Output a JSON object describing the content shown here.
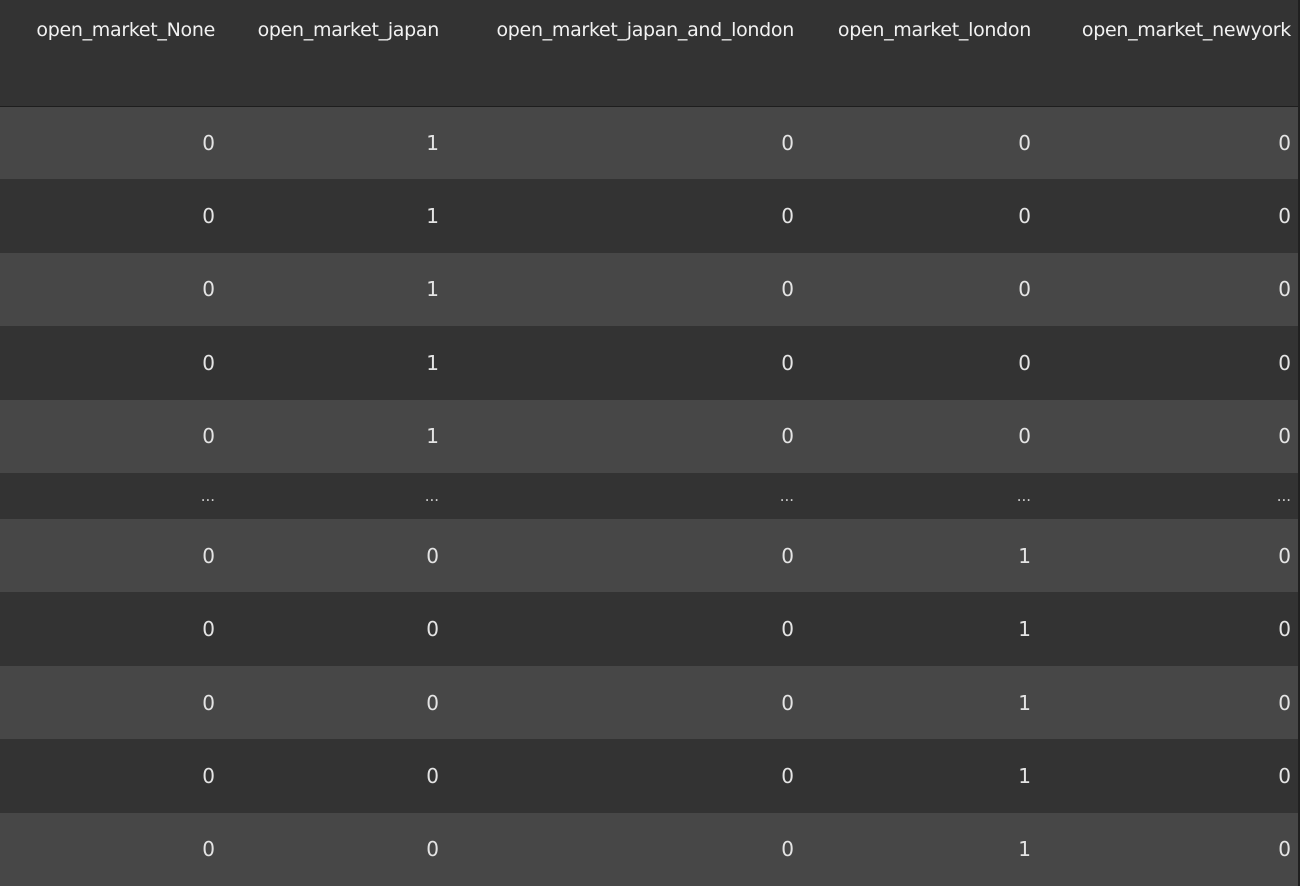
{
  "table": {
    "columns": [
      "open_market_None",
      "open_market_japan",
      "open_market_japan_and_london",
      "open_market_london",
      "open_market_newyork"
    ],
    "rows": [
      [
        "0",
        "1",
        "0",
        "0",
        "0"
      ],
      [
        "0",
        "1",
        "0",
        "0",
        "0"
      ],
      [
        "0",
        "1",
        "0",
        "0",
        "0"
      ],
      [
        "0",
        "1",
        "0",
        "0",
        "0"
      ],
      [
        "0",
        "1",
        "0",
        "0",
        "0"
      ],
      [
        "...",
        "...",
        "...",
        "...",
        "..."
      ],
      [
        "0",
        "0",
        "0",
        "1",
        "0"
      ],
      [
        "0",
        "0",
        "0",
        "1",
        "0"
      ],
      [
        "0",
        "0",
        "0",
        "1",
        "0"
      ],
      [
        "0",
        "0",
        "0",
        "1",
        "0"
      ],
      [
        "0",
        "0",
        "0",
        "1",
        "0"
      ]
    ]
  }
}
